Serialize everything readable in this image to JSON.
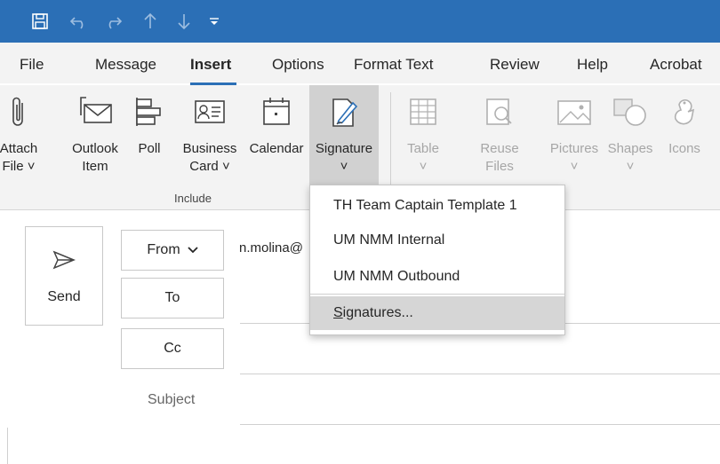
{
  "colors": {
    "title_bar": "#2b6fb6",
    "ribbon_bg": "#f3f3f3",
    "highlight": "#d1d1d1",
    "disabled_text": "#a6a6a6"
  },
  "quick_access": [
    "save-icon",
    "undo-icon",
    "redo-icon",
    "up-icon",
    "down-icon",
    "customize-icon"
  ],
  "tabs": [
    {
      "label": "File"
    },
    {
      "label": "Message"
    },
    {
      "label": "Insert"
    },
    {
      "label": "Options"
    },
    {
      "label": "Format Text"
    },
    {
      "label": "Review"
    },
    {
      "label": "Help"
    },
    {
      "label": "Acrobat"
    }
  ],
  "active_tab": "Insert",
  "ribbon": {
    "attach": {
      "line1": "Attach",
      "line2": "File ˅",
      "icon": "paperclip-icon"
    },
    "outlook_item": {
      "line1": "Outlook",
      "line2": "Item",
      "icon": "envelope-icon"
    },
    "poll": {
      "line1": "Poll",
      "icon": "poll-icon"
    },
    "business_card": {
      "line1": "Business",
      "line2": "Card ˅",
      "icon": "business-card-icon"
    },
    "calendar": {
      "line1": "Calendar",
      "icon": "calendar-icon"
    },
    "signature": {
      "line1": "Signature",
      "line2": "˅",
      "icon": "signature-icon"
    },
    "table": {
      "line1": "Table",
      "line2": "˅",
      "icon": "table-icon"
    },
    "reuse_files": {
      "line1": "Reuse",
      "line2": "Files",
      "icon": "reuse-files-icon"
    },
    "pictures": {
      "line1": "Pictures",
      "line2": "˅",
      "icon": "pictures-icon"
    },
    "shapes": {
      "line1": "Shapes",
      "line2": "˅",
      "icon": "shapes-icon"
    },
    "icons": {
      "line1": "Icons",
      "icon": "icons-icon"
    },
    "include_group_label": "Include"
  },
  "compose": {
    "send_label": "Send",
    "from_label": "From",
    "from_value": "n.molina@",
    "to_label": "To",
    "cc_label": "Cc",
    "subject_label": "Subject"
  },
  "signature_menu": {
    "items": [
      "TH Team Captain Template 1",
      "UM NMM Internal",
      "UM NMM Outbound"
    ],
    "manage": {
      "underlined": "S",
      "rest": "ignatures..."
    }
  }
}
